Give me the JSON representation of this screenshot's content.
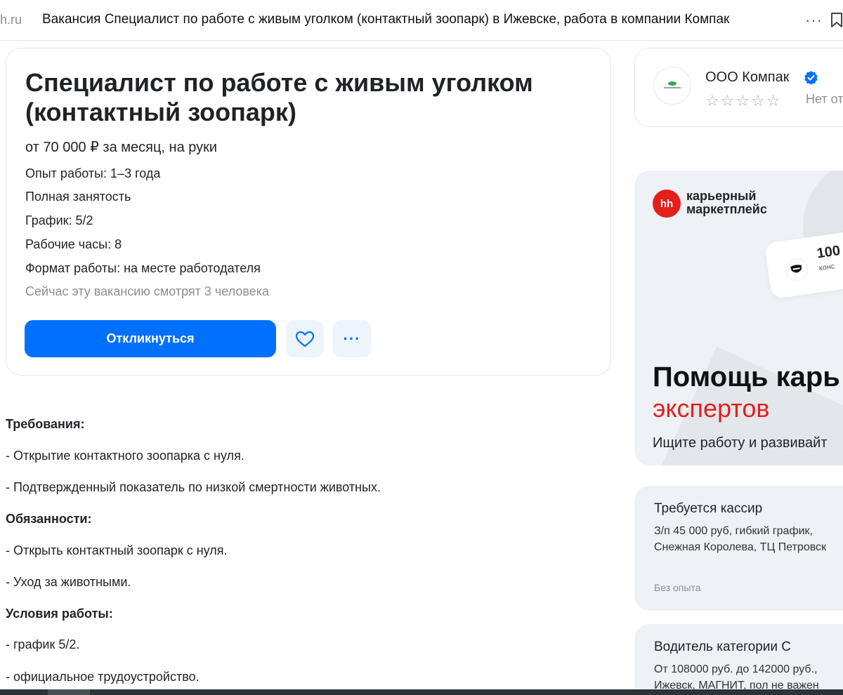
{
  "browser": {
    "domain": "h.ru",
    "page_title": "Вакансия Специалист по работе с живым уголком (контактный зоопарк) в Ижевске, работа в компании Компак",
    "more_label": "···"
  },
  "vacancy": {
    "title": "Специалист по работе с живым уголком (контактный зоопарк)",
    "salary": "от 70 000 ₽ за месяц, на руки",
    "experience": "Опыт работы: 1–3 года",
    "employment": "Полная занятость",
    "schedule": "График: 5/2",
    "hours": "Рабочие часы: 8",
    "format": "Формат работы: на месте работодателя",
    "viewers": "Сейчас эту вакансию смотрят 3 человека",
    "apply_label": "Откликнуться",
    "more_label": "···"
  },
  "description": {
    "requirements_heading": "Требования:",
    "requirements": [
      "- Открытие контактного зоопарка с нуля.",
      "- Подтвержденный показатель по низкой смертности животных."
    ],
    "duties_heading": "Обязанности:",
    "duties": [
      "- Открыть контактный зоопарк с нуля.",
      "- Уход за животными."
    ],
    "conditions_heading": "Условия работы:",
    "conditions": [
      "- график 5/2.",
      "- официальное трудоустройство."
    ]
  },
  "company": {
    "name": "ООО Компак",
    "stars": "☆☆☆☆☆",
    "reviews": "Нет от"
  },
  "promo": {
    "logo_text": "hh",
    "brand": "карьерный\nмаркетплейс",
    "badge_number": "100",
    "badge_sub": "конс",
    "headline": "Помощь карь",
    "headline_accent": "экспертов",
    "subtitle": "Ищите работу и развивайт",
    "accent_color": "#e3201b"
  },
  "jobs": [
    {
      "title": "Требуется кассир",
      "description": "З/п 45 000 руб, гибкий график,\nСнежная Королева, ТЦ Петровск",
      "experience": "Без опыта"
    },
    {
      "title": "Водитель категории С",
      "description": "От 108000 руб. до 142000 руб.,\nИжевск, МАГНИТ, пол не важен",
      "experience": ""
    }
  ],
  "colors": {
    "primary": "#0070ff",
    "text": "#1f2226",
    "muted": "#8a8f96"
  }
}
